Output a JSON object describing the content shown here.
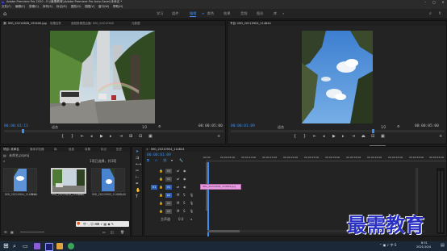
{
  "app": {
    "title": "Adobe Premiere Pro 2020 - E:\\\\最需教育\\\\Adobe Premiere Pro Auto-Save\\\\未命名 *"
  },
  "menu": [
    "文件(F)",
    "编辑(E)",
    "剪辑(C)",
    "序列(S)",
    "标记(M)",
    "图形(G)",
    "视图(V)",
    "窗口(W)",
    "帮助(H)"
  ],
  "workspaces": [
    {
      "label": "学习",
      "active": false
    },
    {
      "label": "组件",
      "active": false
    },
    {
      "label": "编辑",
      "active": true
    },
    {
      "label": "颜色",
      "active": false
    },
    {
      "label": "效果",
      "active": false
    },
    {
      "label": "音频",
      "active": false
    },
    {
      "label": "图形",
      "active": false
    },
    {
      "label": "库",
      "active": false
    }
  ],
  "source_monitor": {
    "tabs": [
      "源: IMG_20210828_155400.jpg",
      "效果控件",
      "音频剪辑混合器: IMG_20210905",
      "元数据"
    ],
    "timecode_in": "00:00:01:11",
    "fit": "适合",
    "ratio": "1/2",
    "timecode_out": "00:00:05:00"
  },
  "program_monitor": {
    "tab": "节目: IMG_20210904_114844",
    "timecode_in": "00:00:01:09",
    "fit": "适合",
    "ratio": "1/2",
    "timecode_out": "00:00:05:00"
  },
  "project_panel": {
    "tabs": [
      "项目: 未命名",
      "媒体浏览器",
      "库",
      "信息",
      "效果",
      "标记",
      "历史"
    ],
    "project_name": "未命名.prproj",
    "item_count": "1项已选择，共3项",
    "items": [
      {
        "name": "IMG_20210904_114844...",
        "duration": "5:00"
      },
      {
        "name": "IMG_20210828_155400...",
        "duration": "5:00"
      },
      {
        "name": "IMG_20210905_11484...",
        "duration": "5:00"
      }
    ]
  },
  "timeline": {
    "tab": "IMG_20210904_114844",
    "timecode": "00:00:01:09",
    "ruler": [
      ":00:00",
      "00:00:05:00",
      "00:00:10:00",
      "00:00:15:00",
      "00:00:20:00",
      "00:00:25:00",
      "00:00:30:00",
      "00:00:35:00",
      "00:00:40:00",
      "00:00:45:00",
      "00:00:50:00",
      "00:00:55:00"
    ],
    "tracks": [
      "V3",
      "V2",
      "V1",
      "A1",
      "A2",
      "A3"
    ],
    "master_label": "主声道",
    "master_value": "0.0",
    "clip_label": "IMG_20210904_114844.jpg"
  },
  "tooltip": "重置",
  "watermark": "最需教育",
  "taskbar": {
    "time": "8:31",
    "date": "2021/10/4"
  },
  "colors": {
    "accent": "#3c8df0",
    "clip": "#e89ce0",
    "watermark": "#2a2fc4"
  }
}
